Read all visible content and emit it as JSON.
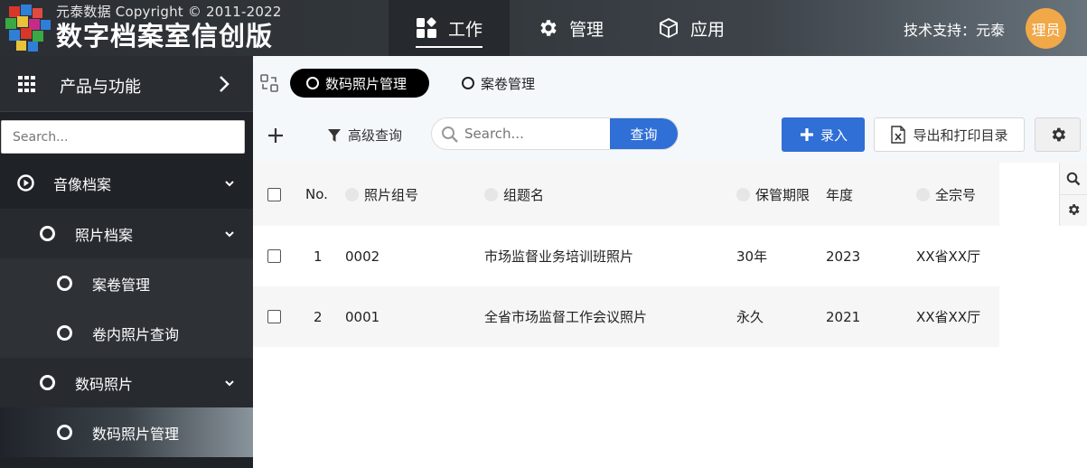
{
  "brand": {
    "copyright": "元泰数据 Copyright © 2011-2022",
    "title": "数字档案室信创版"
  },
  "topnav": [
    {
      "label": "工作",
      "icon": "dashboard-icon",
      "active": true
    },
    {
      "label": "管理",
      "icon": "gear-icon",
      "active": false
    },
    {
      "label": "应用",
      "icon": "cube-icon",
      "active": false
    }
  ],
  "header": {
    "support": "技术支持：元泰",
    "avatar": "理员"
  },
  "sidebar": {
    "title": "产品与功能",
    "search_placeholder": "Search...",
    "items": [
      {
        "label": "音像档案",
        "level": 1,
        "expanded": true
      },
      {
        "label": "照片档案",
        "level": 2,
        "expanded": true
      },
      {
        "label": "案卷管理",
        "level": 3
      },
      {
        "label": "卷内照片查询",
        "level": 3
      },
      {
        "label": "数码照片",
        "level": 2,
        "expanded": true
      },
      {
        "label": "数码照片管理",
        "level": 3,
        "active": true
      }
    ]
  },
  "tabs": [
    {
      "label": "数码照片管理",
      "active": true
    },
    {
      "label": "案卷管理",
      "active": false
    }
  ],
  "toolbar": {
    "advanced_search": "高级查询",
    "search_placeholder": "Search...",
    "query_button": "查询",
    "add_button": "录入",
    "export_button": "导出和打印目录"
  },
  "table": {
    "columns": [
      "No.",
      "照片组号",
      "组题名",
      "保管期限",
      "年度",
      "全宗号"
    ],
    "rows": [
      {
        "no": "1",
        "group_no": "0002",
        "title": "市场监督业务培训班照片",
        "retention": "30年",
        "year": "2023",
        "fonds": "XX省XX厅"
      },
      {
        "no": "2",
        "group_no": "0001",
        "title": "全省市场监督工作会议照片",
        "retention": "永久",
        "year": "2021",
        "fonds": "XX省XX厅"
      }
    ]
  },
  "colors": {
    "accent": "#2f6fd6",
    "avatar": "#f0a848",
    "sidebar": "#1f2226"
  }
}
